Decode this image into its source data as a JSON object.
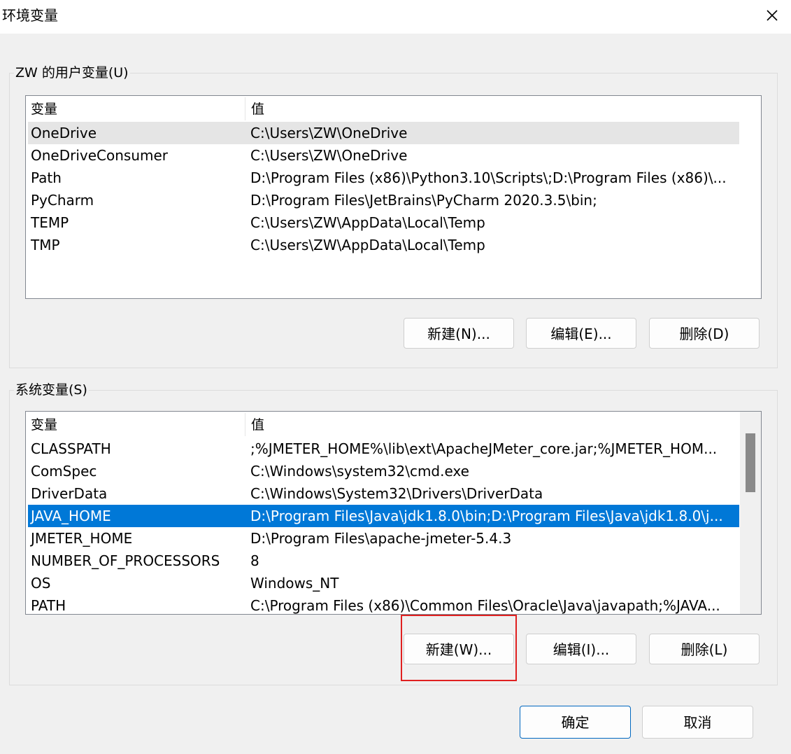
{
  "window": {
    "title": "环境变量"
  },
  "user_vars": {
    "group_label": "ZW 的用户变量(U)",
    "columns": [
      "变量",
      "值"
    ],
    "rows": [
      {
        "name": "OneDrive",
        "value": "C:\\Users\\ZW\\OneDrive"
      },
      {
        "name": "OneDriveConsumer",
        "value": "C:\\Users\\ZW\\OneDrive"
      },
      {
        "name": "Path",
        "value": "D:\\Program Files (x86)\\Python3.10\\Scripts\\;D:\\Program Files (x86)\\..."
      },
      {
        "name": "PyCharm",
        "value": "D:\\Program Files\\JetBrains\\PyCharm 2020.3.5\\bin;"
      },
      {
        "name": "TEMP",
        "value": "C:\\Users\\ZW\\AppData\\Local\\Temp"
      },
      {
        "name": "TMP",
        "value": "C:\\Users\\ZW\\AppData\\Local\\Temp"
      }
    ],
    "buttons": {
      "new": "新建(N)...",
      "edit": "编辑(E)...",
      "delete": "删除(D)"
    }
  },
  "system_vars": {
    "group_label": "系统变量(S)",
    "columns": [
      "变量",
      "值"
    ],
    "rows": [
      {
        "name": "CLASSPATH",
        "value": ";%JMETER_HOME%\\lib\\ext\\ApacheJMeter_core.jar;%JMETER_HOM..."
      },
      {
        "name": "ComSpec",
        "value": "C:\\Windows\\system32\\cmd.exe"
      },
      {
        "name": "DriverData",
        "value": "C:\\Windows\\System32\\Drivers\\DriverData"
      },
      {
        "name": "JAVA_HOME",
        "value": "D:\\Program Files\\Java\\jdk1.8.0\\bin;D:\\Program Files\\Java\\jdk1.8.0\\j..."
      },
      {
        "name": "JMETER_HOME",
        "value": "D:\\Program Files\\apache-jmeter-5.4.3"
      },
      {
        "name": "NUMBER_OF_PROCESSORS",
        "value": "8"
      },
      {
        "name": "OS",
        "value": "Windows_NT"
      },
      {
        "name": "PATH",
        "value": "C:\\Program Files (x86)\\Common Files\\Oracle\\Java\\javapath;%JAVA..."
      }
    ],
    "buttons": {
      "new": "新建(W)...",
      "edit": "编辑(I)...",
      "delete": "删除(L)"
    }
  },
  "footer": {
    "ok": "确定",
    "cancel": "取消"
  },
  "colors": {
    "selection": "#0078d7",
    "highlight_box": "#e02020",
    "primary_border": "#0067c0"
  },
  "icons": {
    "close": "close-icon"
  }
}
